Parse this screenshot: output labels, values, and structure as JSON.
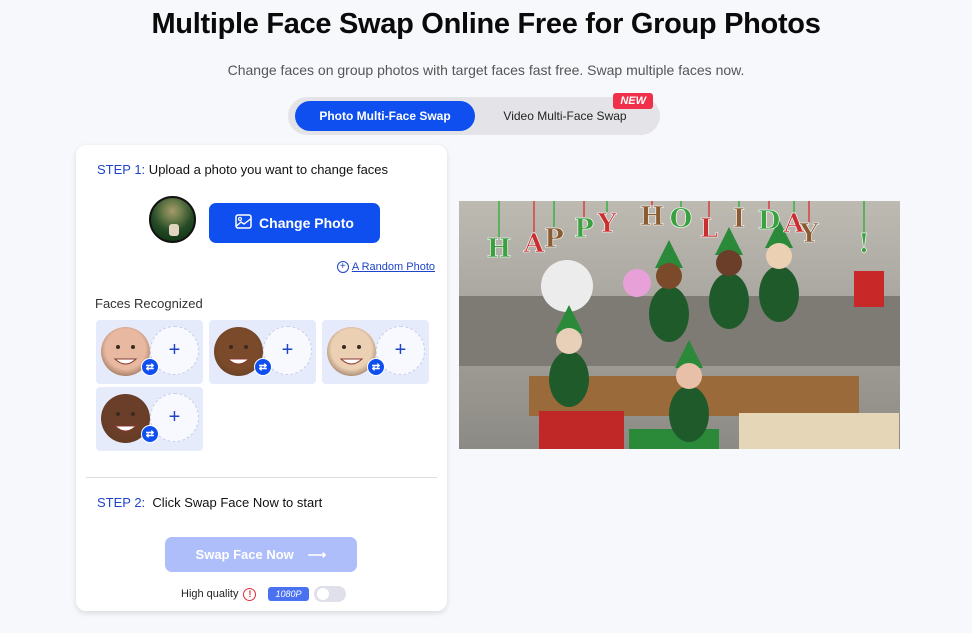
{
  "header": {
    "title": "Multiple Face Swap Online Free for Group Photos",
    "subtitle": "Change faces on group photos with target faces fast free. Swap multiple faces now."
  },
  "tabs": [
    {
      "label": "Photo Multi-Face Swap",
      "active": true
    },
    {
      "label": "Video Multi-Face Swap",
      "active": false,
      "badge": "NEW"
    }
  ],
  "step1": {
    "label": "STEP 1:",
    "text": " Upload a photo you want to change faces",
    "change_button": "Change Photo",
    "change_icon": "image-icon",
    "random_link": "A Random Photo",
    "random_icon": "plus-circle-icon"
  },
  "faces": {
    "label": "Faces Recognized",
    "items": [
      {
        "face": "face-1",
        "skin": "#e8b8a0",
        "add_symbol": "+",
        "swap_symbol": "⇄"
      },
      {
        "face": "face-2",
        "skin": "#7a4a2a",
        "add_symbol": "+",
        "swap_symbol": "⇄"
      },
      {
        "face": "face-3",
        "skin": "#ecd0b4",
        "add_symbol": "+",
        "swap_symbol": "⇄"
      },
      {
        "face": "face-4",
        "skin": "#6a3e28",
        "add_symbol": "+",
        "swap_symbol": "⇄"
      }
    ]
  },
  "step2": {
    "label": "STEP 2:",
    "text": "  Click Swap Face Now to start",
    "swap_button": "Swap Face Now",
    "swap_arrow": "⟶",
    "quality_label": "High quality",
    "quality_info": "!",
    "resolution_badge": "1080P",
    "hq_enabled": false
  },
  "preview": {
    "banner_letters": [
      "H",
      "A",
      "P",
      "P",
      "Y",
      "H",
      "O",
      "L",
      "I",
      "D",
      "A",
      "Y",
      "!"
    ]
  },
  "colors": {
    "primary": "#0f4ff0",
    "primary_disabled": "#aebefa",
    "step_label": "#1f44c9",
    "new_badge": "#f0304a",
    "face_card_bg": "#e6ebfb"
  }
}
